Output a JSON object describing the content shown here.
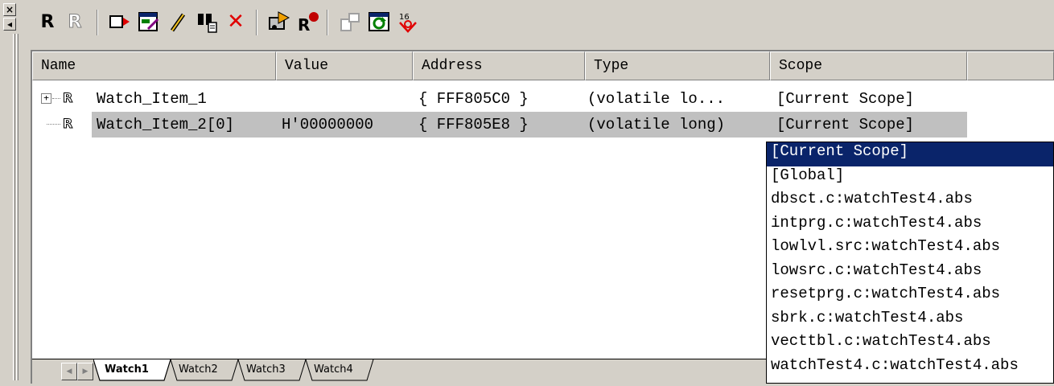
{
  "window": {
    "dock_close_glyph": "×",
    "dock_pin_glyph": "◂"
  },
  "toolbar": {
    "buttons": [
      {
        "icon": "r-bold-icon",
        "glyph": "R"
      },
      {
        "icon": "r-outline-icon",
        "glyph": "R"
      },
      {
        "icon": "add-watch-icon"
      },
      {
        "icon": "edit-value-icon"
      },
      {
        "icon": "pencil-icon"
      },
      {
        "icon": "find-icon"
      },
      {
        "icon": "delete-icon",
        "glyph": "✕"
      },
      {
        "icon": "recalc-icon"
      },
      {
        "icon": "set-breakpoint-icon"
      },
      {
        "icon": "expand-icon"
      },
      {
        "icon": "refresh-icon"
      },
      {
        "icon": "radix-icon",
        "glyph": "16"
      }
    ]
  },
  "watch_table": {
    "columns": [
      "Name",
      "Value",
      "Address",
      "Type",
      "Scope"
    ],
    "rows": [
      {
        "name": "Watch_Item_1",
        "value": "",
        "address": "{ FFF805C0 }",
        "type": "(volatile lo...",
        "scope": "[Current Scope]",
        "expander": "+",
        "selected": false
      },
      {
        "name": "Watch_Item_2[0]",
        "value": "H'00000000",
        "address": "{ FFF805E8 }",
        "type": "(volatile long)",
        "scope": "[Current Scope]",
        "expander": "",
        "selected": true
      }
    ]
  },
  "tabs": {
    "items": [
      "Watch1",
      "Watch2",
      "Watch3",
      "Watch4"
    ],
    "active": "Watch1"
  },
  "scope_dropdown": {
    "items": [
      "[Current Scope]",
      "[Global]",
      "dbsct.c:watchTest4.abs",
      "intprg.c:watchTest4.abs",
      "lowlvl.src:watchTest4.abs",
      "lowsrc.c:watchTest4.abs",
      "resetprg.c:watchTest4.abs",
      "sbrk.c:watchTest4.abs",
      "vecttbl.c:watchTest4.abs",
      "watchTest4.c:watchTest4.abs"
    ],
    "highlighted": "[Current Scope]"
  },
  "colors": {
    "chrome": "#d4d0c8",
    "selection_row": "#c0c0c0",
    "highlight": "#0a246a",
    "delete_red": "#e00000"
  }
}
